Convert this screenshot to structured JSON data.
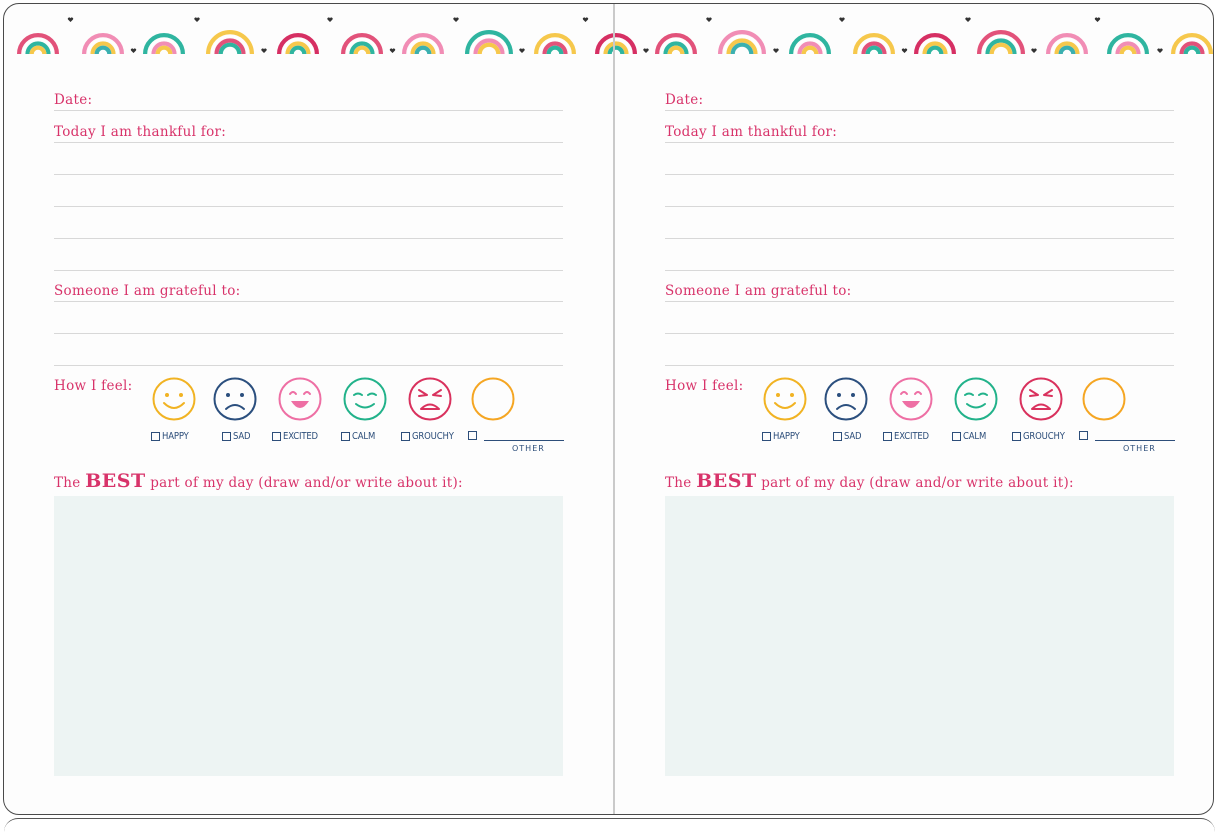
{
  "journal": {
    "pages": [
      {
        "date_label": "Date:",
        "thankful_label": "Today I am thankful for:",
        "grateful_label": "Someone I am grateful to:",
        "feel_label": "How I feel:",
        "moods": [
          "HAPPY",
          "SAD",
          "EXCITED",
          "CALM",
          "GROUCHY"
        ],
        "other_label": "OTHER",
        "best_prefix": "The",
        "best_word": "BEST",
        "best_suffix": "part of my day (draw and/or write about it):"
      },
      {
        "date_label": "Date:",
        "thankful_label": "Today I am thankful for:",
        "grateful_label": "Someone I am grateful to:",
        "feel_label": "How I feel:",
        "moods": [
          "HAPPY",
          "SAD",
          "EXCITED",
          "CALM",
          "GROUCHY"
        ],
        "other_label": "OTHER",
        "best_prefix": "The",
        "best_word": "BEST",
        "best_suffix": "part of my day (draw and/or write about it):"
      }
    ],
    "colors": {
      "label_pink": "#d8336a",
      "mood_blue": "#2d4e7a",
      "happy_yellow": "#f1b323",
      "sad_navy": "#2b4f7e",
      "excited_pink": "#ee6fa4",
      "calm_green": "#22b28a",
      "grouchy_red": "#d9315d",
      "other_orange": "#f5a623",
      "draw_area": "#edf4f3"
    },
    "icons": [
      "rainbow-icon",
      "heart-icon",
      "happy-face-icon",
      "sad-face-icon",
      "excited-face-icon",
      "calm-face-icon",
      "grouchy-face-icon",
      "blank-face-icon"
    ]
  }
}
